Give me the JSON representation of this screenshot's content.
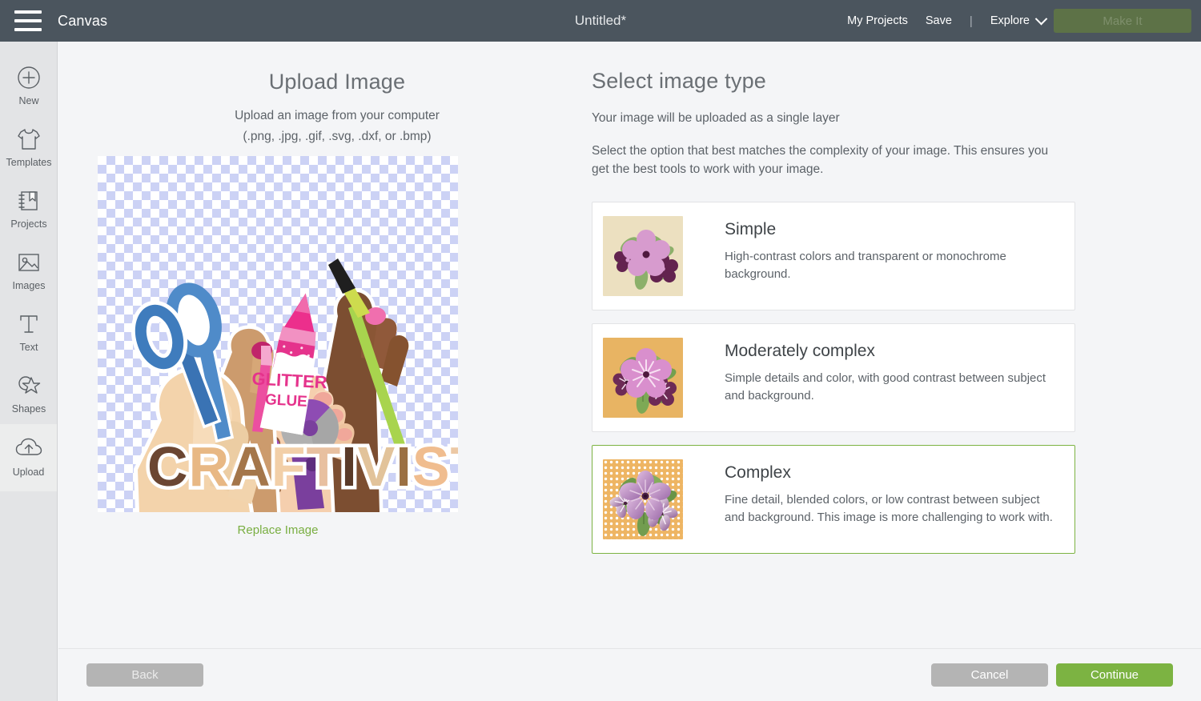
{
  "topbar": {
    "menu_icon": "hamburger-menu-icon",
    "canvas_label": "Canvas",
    "document_title": "Untitled*",
    "my_projects_label": "My Projects",
    "save_label": "Save",
    "separator": "|",
    "explore_label": "Explore",
    "explore_chevron_icon": "chevron-down-icon",
    "make_it_label": "Make It",
    "bg_color": "#4b555e",
    "make_it_color": "#5d7247"
  },
  "sidebar": {
    "items": [
      {
        "label": "New",
        "icon": "plus-circle-icon"
      },
      {
        "label": "Templates",
        "icon": "tshirt-icon"
      },
      {
        "label": "Projects",
        "icon": "notebook-bookmark-icon"
      },
      {
        "label": "Images",
        "icon": "picture-icon"
      },
      {
        "label": "Text",
        "icon": "text-t-icon"
      },
      {
        "label": "Shapes",
        "icon": "shapes-star-icon"
      }
    ],
    "upload": {
      "label": "Upload",
      "icon": "cloud-upload-icon"
    }
  },
  "upload_panel": {
    "title": "Upload Image",
    "subtitle_1": "Upload an image from your computer",
    "subtitle_2": "(.png, .jpg, .gif, .svg, .dxf, or .bmp)",
    "replace_link": "Replace Image",
    "replace_link_color": "#79ae41",
    "preview_alt": "craftivist-raised-hands-artwork",
    "preview_word": "CRAFTIVIST",
    "preview_glue_label": "GLITTER GLUE",
    "checker_color": "#ccd2f5"
  },
  "image_type_panel": {
    "title": "Select image type",
    "note": "Your image will be uploaded as a single layer",
    "instructions": "Select the option that best matches the complexity of your image. This ensures you get the best tools to work with your image.",
    "options": [
      {
        "name": "Simple",
        "description": "High-contrast colors and transparent or monochrome background.",
        "thumbnail": "simple-flower-thumbnail",
        "thumb_bg": "#ece0c0",
        "selected": false
      },
      {
        "name": "Moderately complex",
        "description": "Simple details and color, with good contrast between subject and background.",
        "thumbnail": "moderately-complex-flower-thumbnail",
        "thumb_bg": "#e8b463",
        "selected": false
      },
      {
        "name": "Complex",
        "description": "Fine detail, blended colors, or low contrast between subject and background. This image is more challenging to work with.",
        "thumbnail": "complex-flower-thumbnail",
        "thumb_bg": "#eeb563",
        "selected": true
      }
    ],
    "selected_border_color": "#7cb342"
  },
  "footer": {
    "back_label": "Back",
    "cancel_label": "Cancel",
    "continue_label": "Continue",
    "continue_color": "#7cb342",
    "disabled_color": "#b4b4b4"
  }
}
